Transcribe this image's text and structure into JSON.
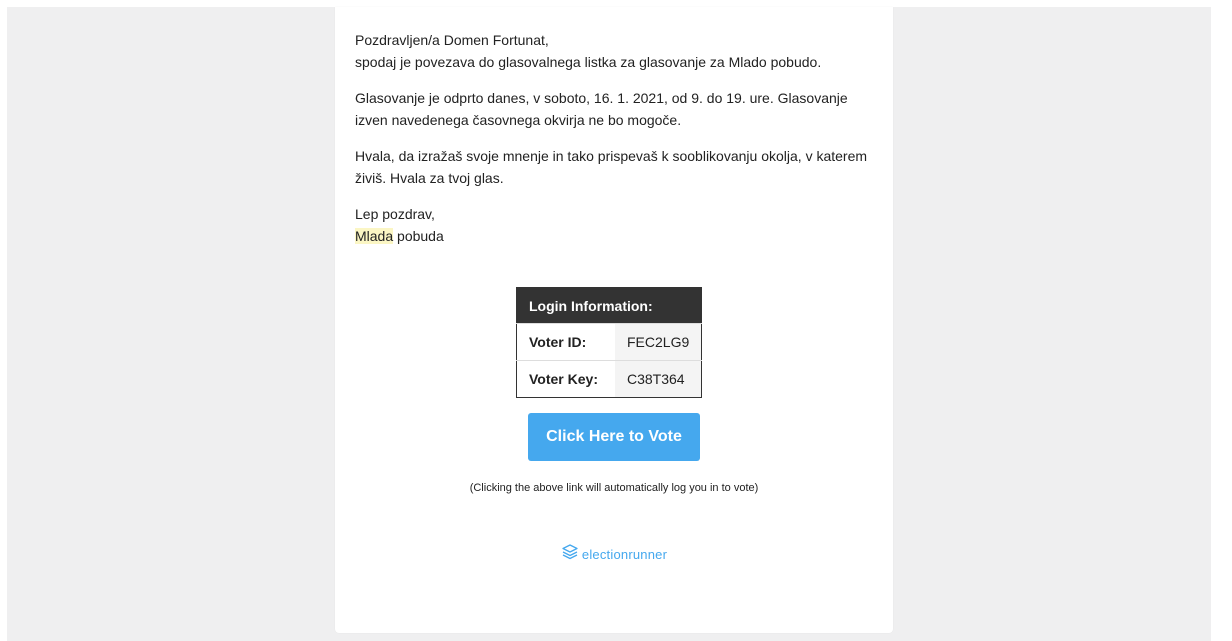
{
  "email": {
    "greeting": "Pozdravljen/a Domen Fortunat,",
    "intro": "spodaj je povezava do glasovalnega listka za glasovanje za Mlado pobudo.",
    "schedule": "Glasovanje je odprto danes, v soboto, 16. 1. 2021, od 9. do 19. ure. Glasovanje izven navedenega časovnega okvirja ne bo mogoče.",
    "thanks": "Hvala, da izražaš svoje mnenje in tako prispevaš k sooblikovanju okolja, v katerem živiš. Hvala za tvoj glas.",
    "closing": "Lep pozdrav,",
    "signature_highlight": "Mlada",
    "signature_rest": "pobuda"
  },
  "login": {
    "header": "Login Information:",
    "rows": [
      {
        "label": "Voter ID:",
        "value": "FEC2LG9"
      },
      {
        "label": "Voter Key:",
        "value": "C38T364"
      }
    ]
  },
  "vote_button": {
    "label": "Click Here to Vote"
  },
  "note": "(Clicking the above link will automatically log you in to vote)",
  "logo": {
    "text": "electionrunner",
    "icon": "electionrunner-logo-icon"
  },
  "colors": {
    "accent": "#45a8ee",
    "table_header": "#333333",
    "highlight": "#fbf6c4",
    "page_bg": "#efeff0"
  }
}
